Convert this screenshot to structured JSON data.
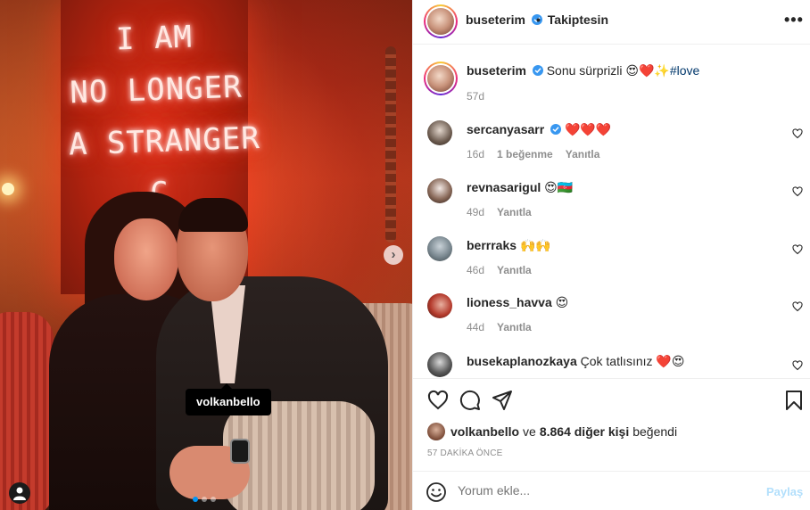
{
  "photo": {
    "neon_lines": [
      "I AM",
      "NO LONGER",
      "A STRANGER",
      "C"
    ],
    "tag_user": "volkanbello",
    "carousel_dots": 3,
    "carousel_active": 0
  },
  "header": {
    "username": "buseterim",
    "separator": "•",
    "follow_status": "Takiptesin",
    "more": "•••"
  },
  "caption": {
    "username": "buseterim",
    "text": "Sonu sürprizli 😍❤️✨",
    "hashtag": "#love",
    "age": "57d"
  },
  "comments": [
    {
      "username": "sercanyasarr",
      "verified": true,
      "text": "❤️❤️❤️",
      "age": "16d",
      "likes": "1 beğenme",
      "reply": "Yanıtla"
    },
    {
      "username": "revnasarigul",
      "verified": false,
      "text": "😍🇦🇿",
      "age": "49d",
      "likes": "",
      "reply": "Yanıtla"
    },
    {
      "username": "berrraks",
      "verified": false,
      "text": "🙌🙌",
      "age": "46d",
      "likes": "",
      "reply": "Yanıtla"
    },
    {
      "username": "lioness_havva",
      "verified": false,
      "text": "😍",
      "age": "44d",
      "likes": "",
      "reply": "Yanıtla"
    },
    {
      "username": "busekaplanozkaya",
      "verified": false,
      "text": "Çok tatlısınız ❤️😍",
      "age": "",
      "likes": "",
      "reply": ""
    }
  ],
  "likes": {
    "first_user": "volkanbello",
    "connector": "ve",
    "others": "8.864 diğer kişi",
    "suffix": "beğendi"
  },
  "timestamp": "57 DAKİKA ÖNCE",
  "add_comment": {
    "placeholder": "Yorum ekle...",
    "post_label": "Paylaş"
  },
  "colors": {
    "link": "#00376b",
    "verified": "#3897f0",
    "post_disabled": "#b2dffc",
    "carousel_active": "#0095f6"
  }
}
